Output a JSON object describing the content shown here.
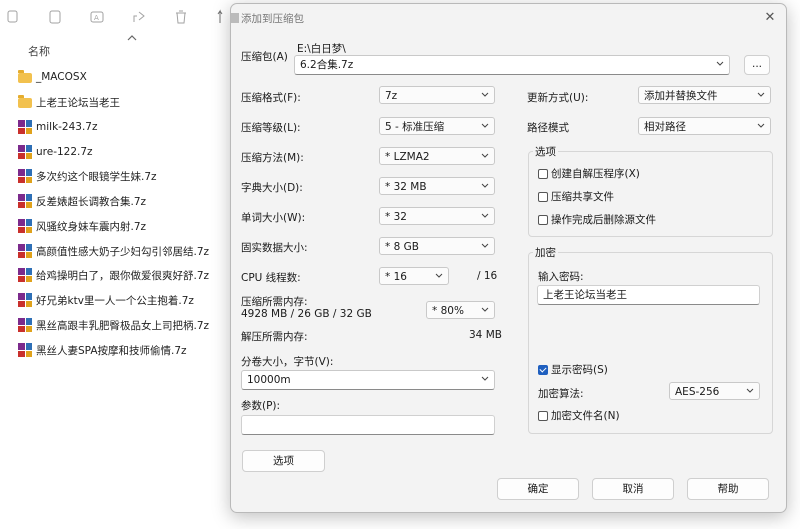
{
  "explorer": {
    "column_header": "名称",
    "files": [
      {
        "name": "_MACOSX",
        "type": "folder"
      },
      {
        "name": "上老王论坛当老王",
        "type": "folder"
      },
      {
        "name": "milk-243.7z",
        "type": "archive"
      },
      {
        "name": "ure-122.7z",
        "type": "archive"
      },
      {
        "name": "多次约这个眼镜学生妹.7z",
        "type": "archive"
      },
      {
        "name": "反差婊超长调教合集.7z",
        "type": "archive"
      },
      {
        "name": "风骚纹身妹车震内射.7z",
        "type": "archive"
      },
      {
        "name": "高颜值性感大奶子少妇勾引邻居结.7z",
        "type": "archive"
      },
      {
        "name": "给鸡操明白了，跟你做爱很爽好舒.7z",
        "type": "archive"
      },
      {
        "name": "好兄弟ktv里一人一个公主抱着.7z",
        "type": "archive"
      },
      {
        "name": "黑丝高跟丰乳肥臀极品女上司把柄.7z",
        "type": "archive"
      },
      {
        "name": "黑丝人妻SPA按摩和技师偷情.7z",
        "type": "archive"
      }
    ]
  },
  "dialog": {
    "title": "添加到压缩包",
    "archive_label": "压缩包(A)",
    "archive_path": "E:\\白日梦\\",
    "archive_name": "6.2合集.7z",
    "browse_label": "...",
    "format_label": "压缩格式(F):",
    "format_value": "7z",
    "level_label": "压缩等级(L):",
    "level_value": "5 - 标准压缩",
    "method_label": "压缩方法(M):",
    "method_value": "* LZMA2",
    "dict_label": "字典大小(D):",
    "dict_value": "* 32 MB",
    "word_label": "单词大小(W):",
    "word_value": "* 32",
    "solid_label": "固实数据大小:",
    "solid_value": "* 8 GB",
    "threads_label": "CPU 线程数:",
    "threads_value": "* 16",
    "threads_total": "/ 16",
    "mem_comp_label": "压缩所需内存:",
    "mem_comp_detail": "4928 MB / 26 GB / 32 GB",
    "mem_comp_value": "* 80%",
    "mem_decomp_label": "解压所需内存:",
    "mem_decomp_value": "34 MB",
    "split_label": "分卷大小，字节(V):",
    "split_value": "10000m",
    "params_label": "参数(P):",
    "params_value": "",
    "options_button": "选项",
    "update_label": "更新方式(U):",
    "update_value": "添加并替换文件",
    "path_mode_label": "路径模式",
    "path_mode_value": "相对路径",
    "options_group": "选项",
    "opt_sfx": "创建自解压程序(X)",
    "opt_shared": "压缩共享文件",
    "opt_delete": "操作完成后删除源文件",
    "encrypt_group": "加密",
    "password_label": "输入密码:",
    "password_value": "上老王论坛当老王",
    "show_password": "显示密码(S)",
    "show_password_checked": true,
    "algo_label": "加密算法:",
    "algo_value": "AES-256",
    "encrypt_names": "加密文件名(N)",
    "ok": "确定",
    "cancel": "取消",
    "help": "帮助"
  }
}
